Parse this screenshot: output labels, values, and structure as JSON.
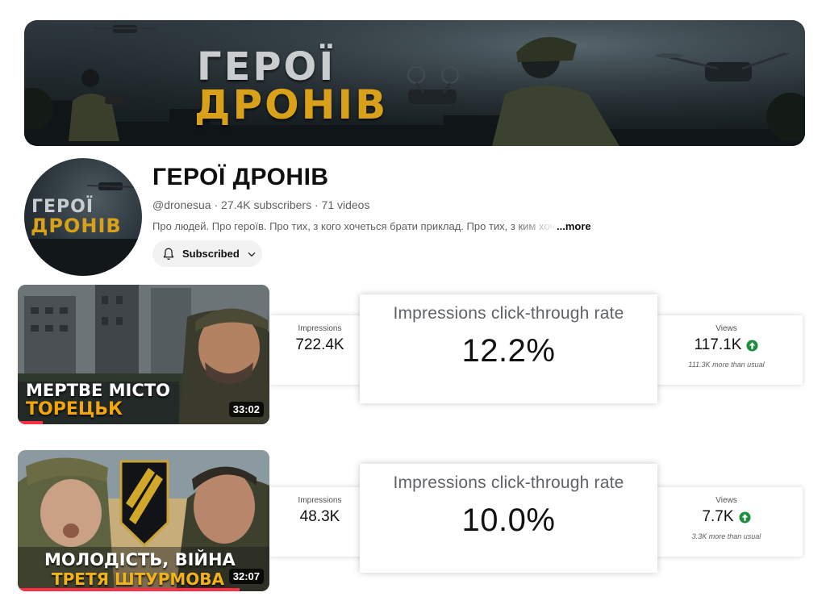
{
  "banner": {
    "title_line1": "ГЕРОЇ",
    "title_line2": "ДРОНІВ"
  },
  "channel": {
    "avatar_line1": "ГЕРОЇ",
    "avatar_line2": "ДРОНІВ",
    "name": "ГЕРОЇ ДРОНІВ",
    "meta": "@dronesua · 27.4K subscribers · 71 videos",
    "description": "Про людей. Про героїв. Про тих, з кого хочеться брати приклад. Про тих, з ким хоче",
    "more_label": "...more",
    "subscribe_label": "Subscribed"
  },
  "videos": [
    {
      "thumb_line1": "МЕРТВЕ МІСТО",
      "thumb_line2": "ТОРЕЦЬК",
      "duration": "33:02",
      "watched_fraction": 0.1,
      "impressions_label": "Impressions",
      "impressions_value": "722.4K",
      "ctr_label": "Impressions click-through rate",
      "ctr_value": "12.2%",
      "views_label": "Views",
      "views_value": "117.1K",
      "views_sub": "111.3K more than usual"
    },
    {
      "thumb_line1": "МОЛОДІСТЬ, ВІЙНА",
      "thumb_line2": "ТРЕТЯ ШТУРМОВА",
      "duration": "32:07",
      "watched_fraction": 0.88,
      "impressions_label": "Impressions",
      "impressions_value": "48.3K",
      "ctr_label": "Impressions click-through rate",
      "ctr_value": "10.0%",
      "views_label": "Views",
      "views_value": "7.7K",
      "views_sub": "3.3K more than usual"
    }
  ],
  "colors": {
    "accent_gold": "#d9a11a",
    "up_green": "#1e8e3e",
    "progress_red": "#ff2f45"
  },
  "icons": {
    "subscribe": "bell-icon",
    "dropdown": "chevron-down-icon",
    "trend": "arrow-up-circle-icon"
  }
}
